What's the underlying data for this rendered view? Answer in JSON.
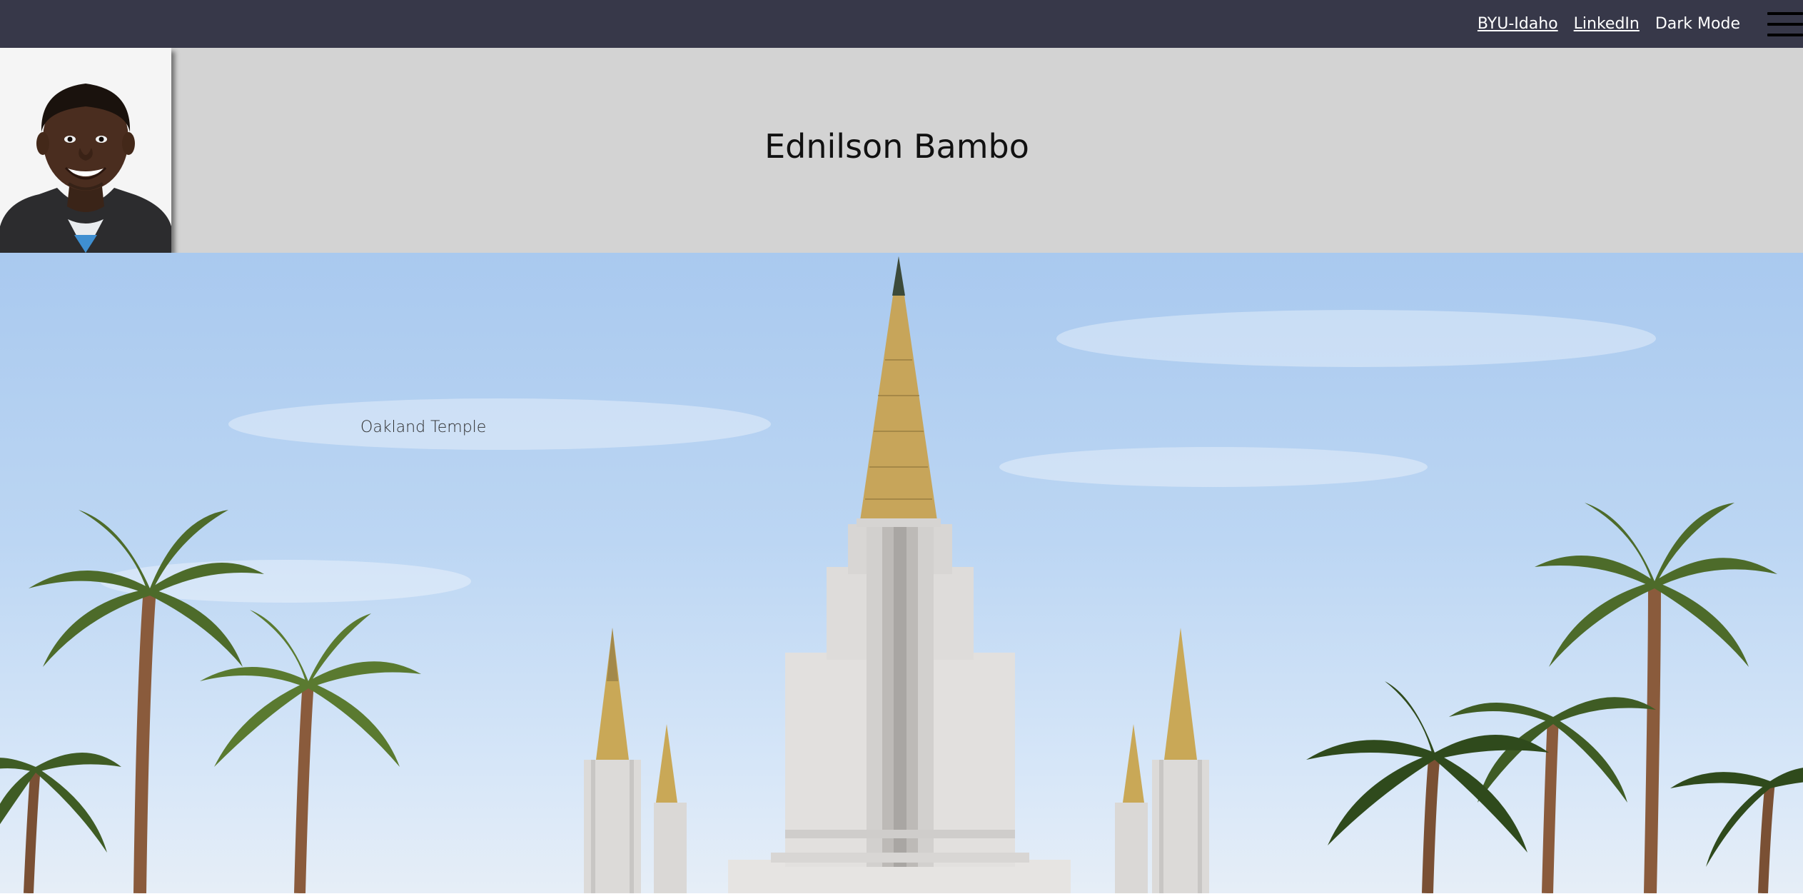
{
  "nav": {
    "links": [
      {
        "label": "BYU-Idaho"
      },
      {
        "label": "LinkedIn"
      }
    ],
    "dark_mode_label": "Dark Mode",
    "menu_icon": "hamburger-menu-icon"
  },
  "header": {
    "title": "Ednilson Bambo"
  },
  "hero": {
    "caption": "Oakland Temple"
  },
  "colors": {
    "nav_background": "#373849",
    "header_background": "#d3d3d3"
  }
}
